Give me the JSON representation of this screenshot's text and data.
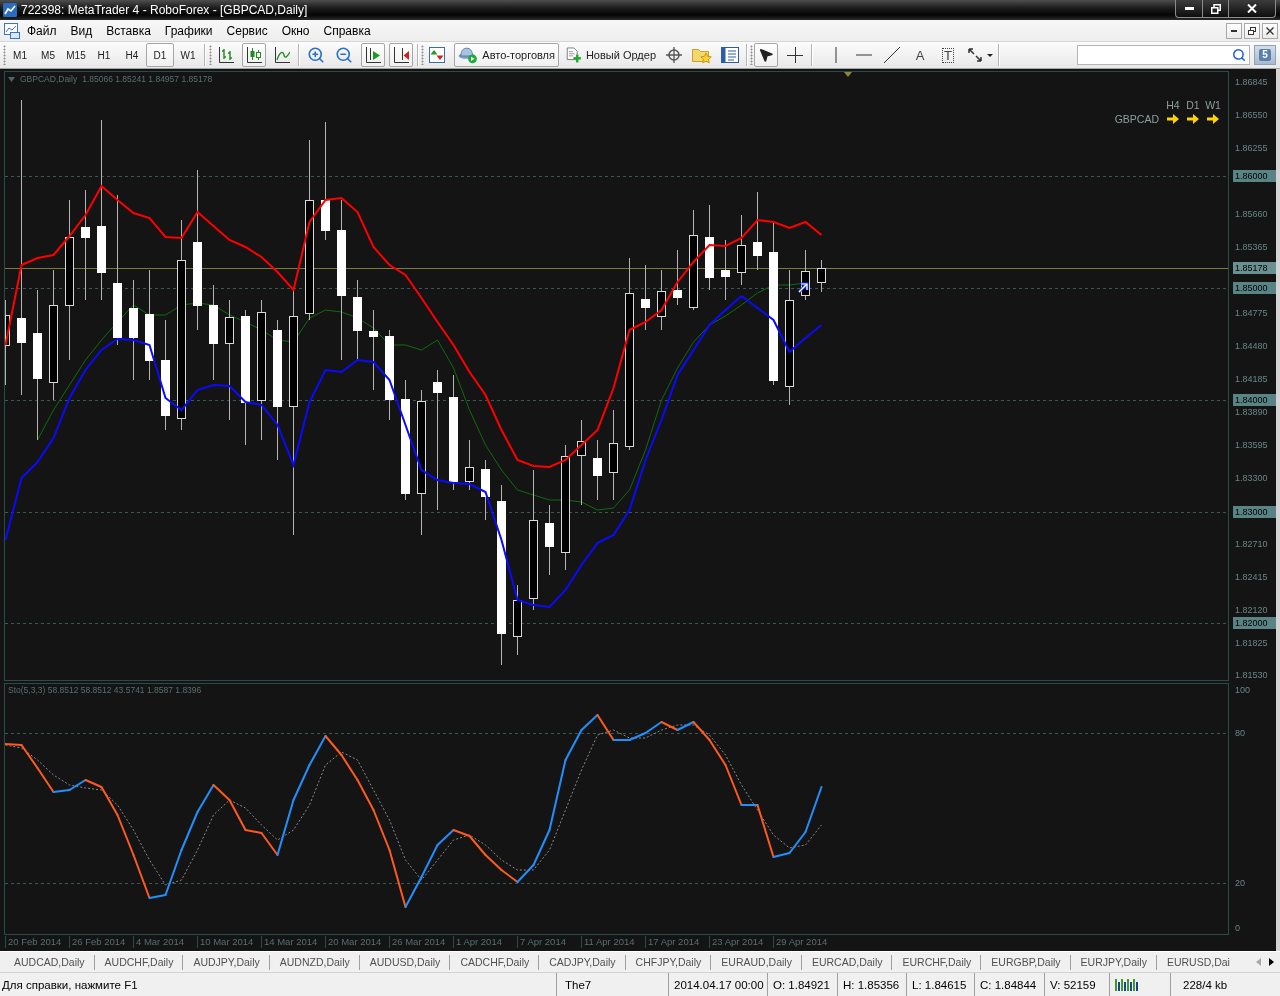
{
  "window": {
    "title": "722398: MetaTrader 4 - RoboForex - [GBPCAD,Daily]"
  },
  "menu": [
    "Файл",
    "Вид",
    "Вставка",
    "Графики",
    "Сервис",
    "Окно",
    "Справка"
  ],
  "toolbar": {
    "timeframes": [
      {
        "label": "M1",
        "selected": false
      },
      {
        "label": "M5",
        "selected": false
      },
      {
        "label": "M15",
        "selected": false
      },
      {
        "label": "H1",
        "selected": false
      },
      {
        "label": "H4",
        "selected": false
      },
      {
        "label": "D1",
        "selected": true
      },
      {
        "label": "W1",
        "selected": false
      }
    ],
    "chart_types": [
      {
        "kind": "bars",
        "selected": false
      },
      {
        "kind": "candles",
        "selected": true
      },
      {
        "kind": "line",
        "selected": false
      }
    ],
    "view_buttons": [
      {
        "kind": "zoom-in",
        "selected": false
      },
      {
        "kind": "zoom-out",
        "selected": false
      },
      {
        "kind": "chart-shift",
        "selected": true
      },
      {
        "kind": "auto-scroll",
        "selected": true
      }
    ],
    "auto_trading": {
      "label": "Авто-торговля",
      "on": true
    },
    "new_order": {
      "label": "Новый Ордер"
    },
    "drawing_tools": [
      {
        "kind": "cursor",
        "selected": true
      },
      {
        "kind": "crosshair",
        "selected": false
      },
      {
        "kind": "vertical-line",
        "selected": false
      },
      {
        "kind": "horizontal-line",
        "selected": false
      },
      {
        "kind": "trend-line",
        "selected": false
      },
      {
        "kind": "text",
        "glyph": "A",
        "selected": false
      },
      {
        "kind": "text-label",
        "glyph": "T",
        "selected": false
      },
      {
        "kind": "shapes",
        "selected": false
      }
    ],
    "notifications": {
      "count": "5"
    }
  },
  "chart": {
    "symbol": "GBPCAD,Daily",
    "ohlc": "1.85066 1.85241 1.84957 1.85178",
    "trend_panel": {
      "timeframes": [
        "H4",
        "D1",
        "W1"
      ],
      "symbol": "GBPCAD"
    },
    "price_axis": [
      {
        "label": "1.86845",
        "kind": "tick"
      },
      {
        "label": "1.86550",
        "kind": "tick"
      },
      {
        "label": "1.86255",
        "kind": "tick"
      },
      {
        "label": "1.86000",
        "kind": "grid"
      },
      {
        "label": "1.85660",
        "kind": "tick"
      },
      {
        "label": "1.85365",
        "kind": "tick"
      },
      {
        "label": "1.85178",
        "kind": "bid"
      },
      {
        "label": "1.85000",
        "kind": "grid"
      },
      {
        "label": "1.84775",
        "kind": "tick"
      },
      {
        "label": "1.84480",
        "kind": "tick"
      },
      {
        "label": "1.84185",
        "kind": "tick"
      },
      {
        "label": "1.84000",
        "kind": "grid"
      },
      {
        "label": "1.83890",
        "kind": "tick"
      },
      {
        "label": "1.83595",
        "kind": "tick"
      },
      {
        "label": "1.83300",
        "kind": "tick"
      },
      {
        "label": "1.83000",
        "kind": "grid"
      },
      {
        "label": "1.82710",
        "kind": "tick"
      },
      {
        "label": "1.82415",
        "kind": "tick"
      },
      {
        "label": "1.82120",
        "kind": "tick"
      },
      {
        "label": "1.82000",
        "kind": "grid"
      },
      {
        "label": "1.81825",
        "kind": "tick"
      },
      {
        "label": "1.81530",
        "kind": "tick"
      }
    ],
    "indicator": {
      "title": "Sto(5,3,3) 58.8512 58.8512 43.5741 1.8587 1.8396",
      "levels": [
        "100",
        "80",
        "20",
        "0"
      ]
    },
    "date_axis": [
      "20 Feb 2014",
      "26 Feb 2014",
      "4 Mar 2014",
      "10 Mar 2014",
      "14 Mar 2014",
      "20 Mar 2014",
      "26 Mar 2014",
      "1 Apr 2014",
      "7 Apr 2014",
      "11 Apr 2014",
      "17 Apr 2014",
      "23 Apr 2014",
      "29 Apr 2014"
    ]
  },
  "tabs": [
    {
      "label": "AUDCAD,Daily",
      "selected": false
    },
    {
      "label": "AUDCHF,Daily",
      "selected": false
    },
    {
      "label": "AUDJPY,Daily",
      "selected": false
    },
    {
      "label": "AUDNZD,Daily",
      "selected": false
    },
    {
      "label": "AUDUSD,Daily",
      "selected": false
    },
    {
      "label": "CADCHF,Daily",
      "selected": false
    },
    {
      "label": "CADJPY,Daily",
      "selected": false
    },
    {
      "label": "CHFJPY,Daily",
      "selected": false
    },
    {
      "label": "EURAUD,Daily",
      "selected": false
    },
    {
      "label": "EURCAD,Daily",
      "selected": false
    },
    {
      "label": "EURCHF,Daily",
      "selected": false
    },
    {
      "label": "EURGBP,Daily",
      "selected": false
    },
    {
      "label": "EURJPY,Daily",
      "selected": false
    },
    {
      "label": "EURUSD,Dai",
      "selected": false
    }
  ],
  "tab_scroll": [
    {
      "disabled": true
    },
    {
      "disabled": false
    }
  ],
  "status_bar": {
    "help": "Для справки, нажмите F1",
    "profile": "The7",
    "time": "2014.04.17 00:00",
    "open": "O: 1.84921",
    "high": "H: 1.85356",
    "low": "L: 1.84615",
    "close": "C: 1.84844",
    "volume": "V: 52159",
    "traffic": "228/4 kb"
  }
}
